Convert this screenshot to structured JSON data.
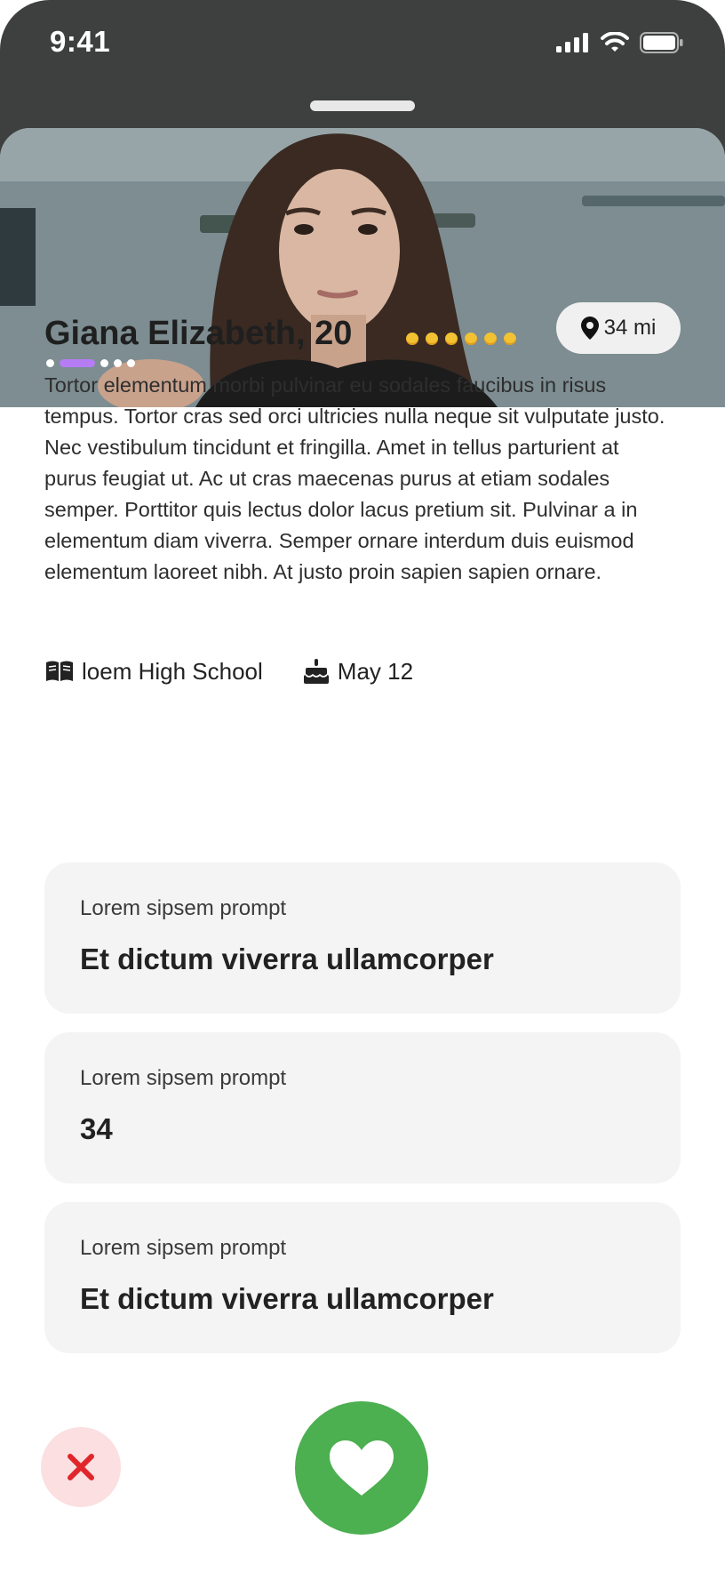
{
  "status_bar": {
    "time": "9:41"
  },
  "profile": {
    "name_age": "Giana Elizabeth, 20",
    "emoji_count": 6,
    "distance": "34 mi",
    "bio": "Tortor elementum morbi pulvinar eu sodales faucibus in risus tempus. Tortor cras sed orci ultricies nulla neque sit vulputate justo. Nec vestibulum tincidunt et fringilla. Amet in tellus parturient at purus feugiat ut. Ac ut cras maecenas purus at etiam sodales semper. Porttitor quis lectus dolor lacus pretium sit. Pulvinar a in elementum diam viverra. Semper ornare interdum duis euismod elementum laoreet nibh. At justo proin sapien sapien ornare.",
    "school": "loem High School",
    "birthday": "May 12",
    "photo_indicator": {
      "count": 5,
      "active_index": 1
    }
  },
  "prompts": [
    {
      "label": "Lorem sipsem prompt",
      "answer": "Et dictum viverra ullamcorper"
    },
    {
      "label": "Lorem sipsem prompt",
      "answer": "34"
    },
    {
      "label": "Lorem sipsem prompt",
      "answer": "Et dictum viverra ullamcorper"
    }
  ],
  "actions": {
    "reject_icon": "close-icon",
    "like_icon": "heart-icon"
  },
  "colors": {
    "accent_purple": "#b67cf3",
    "like_green": "#4caf50",
    "reject_bg": "#fbdfe1",
    "reject_icon": "#e0262b",
    "card_bg": "#f4f4f4",
    "header_dark": "#3e3f3f"
  }
}
